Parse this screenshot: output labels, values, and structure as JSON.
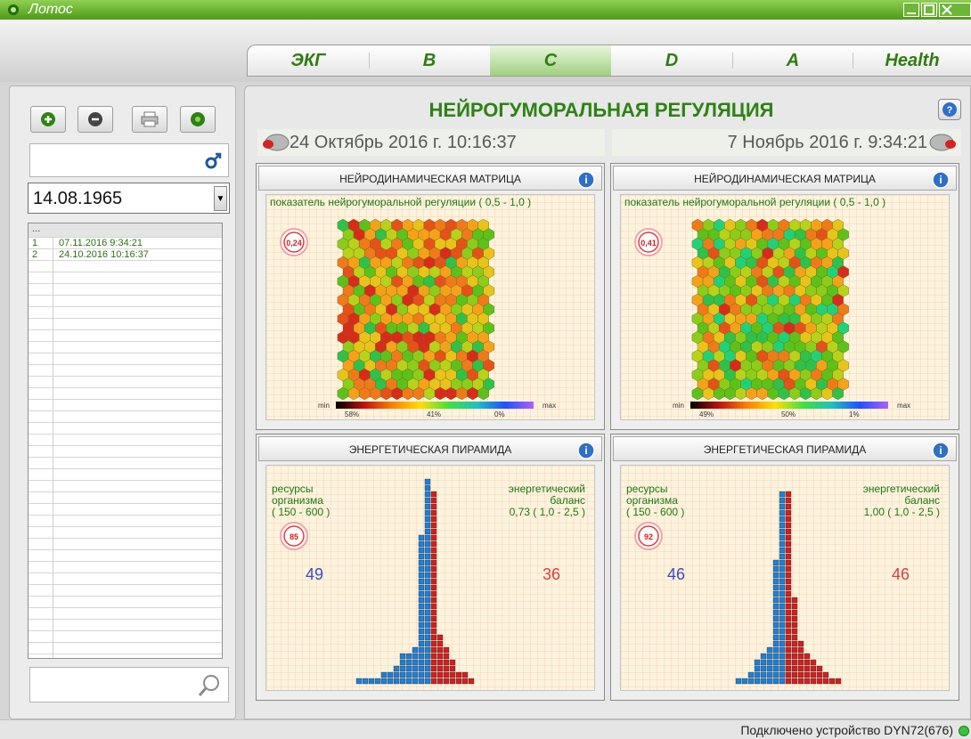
{
  "app": {
    "title": "Лотос"
  },
  "tabs": [
    {
      "label": "ЭКГ"
    },
    {
      "label": "B"
    },
    {
      "label": "C",
      "active": true
    },
    {
      "label": "D"
    },
    {
      "label": "A"
    },
    {
      "label": "Health"
    }
  ],
  "sidebar": {
    "toolbar": [
      {
        "icon": "add-icon"
      },
      {
        "icon": "remove-icon"
      },
      {
        "icon": "print-icon"
      },
      {
        "icon": "lotus-icon"
      }
    ],
    "gender_icon": "male-icon",
    "birth_date": "14.08.1965",
    "records_header": "...",
    "records": [
      {
        "num": "1",
        "datetime": "07.11.2016 9:34:21"
      },
      {
        "num": "2",
        "datetime": "24.10.2016 10:16:37"
      }
    ],
    "search_icon": "search-icon"
  },
  "main": {
    "title": "НЕЙРОГУМОРАЛЬНАЯ РЕГУЛЯЦИЯ",
    "date_left": "24 Октябрь 2016 г. 10:16:37",
    "date_right": "7 Ноябрь 2016 г. 9:34:21",
    "matrix_panels": [
      {
        "title": "НЕЙРОДИНАМИЧЕСКАЯ МАТРИЦА",
        "label": "показатель нейрогуморальной регуляции ( 0,5 - 1,0 )",
        "gauge": "0,24",
        "scale_min": "min",
        "scale_max": "max",
        "scale_values": [
          "58%",
          "41%",
          "0%"
        ]
      },
      {
        "title": "НЕЙРОДИНАМИЧЕСКАЯ МАТРИЦА",
        "label": "показатель нейрогуморальной регуляции ( 0,5 - 1,0 )",
        "gauge": "0,41",
        "scale_min": "min",
        "scale_max": "max",
        "scale_values": [
          "49%",
          "50%",
          "1%"
        ]
      }
    ],
    "pyramid_panels": [
      {
        "title": "ЭНЕРГЕТИЧЕСКАЯ ПИРАМИДА",
        "left_label_1": "ресурсы",
        "left_label_2": "организма",
        "left_label_3": "( 150 - 600 )",
        "right_label_1": "энергетический",
        "right_label_2": "баланс",
        "right_label_3": "0,73 ( 1,0 - 2,5 )",
        "gauge": "85",
        "left_value": "49",
        "right_value": "36"
      },
      {
        "title": "ЭНЕРГЕТИЧЕСКАЯ ПИРАМИДА",
        "left_label_1": "ресурсы",
        "left_label_2": "организма",
        "left_label_3": "( 150 - 600 )",
        "right_label_1": "энергетический",
        "right_label_2": "баланс",
        "right_label_3": "1,00 ( 1,0 - 2,5 )",
        "gauge": "92",
        "left_value": "46",
        "right_value": "46"
      }
    ]
  },
  "status": {
    "text": "Подключено устройство DYN72(676)"
  },
  "colors": {
    "accent": "#2e8214",
    "blue": "#2f7fd0",
    "red": "#cc1f1f",
    "title_green": "#4e9a19"
  }
}
